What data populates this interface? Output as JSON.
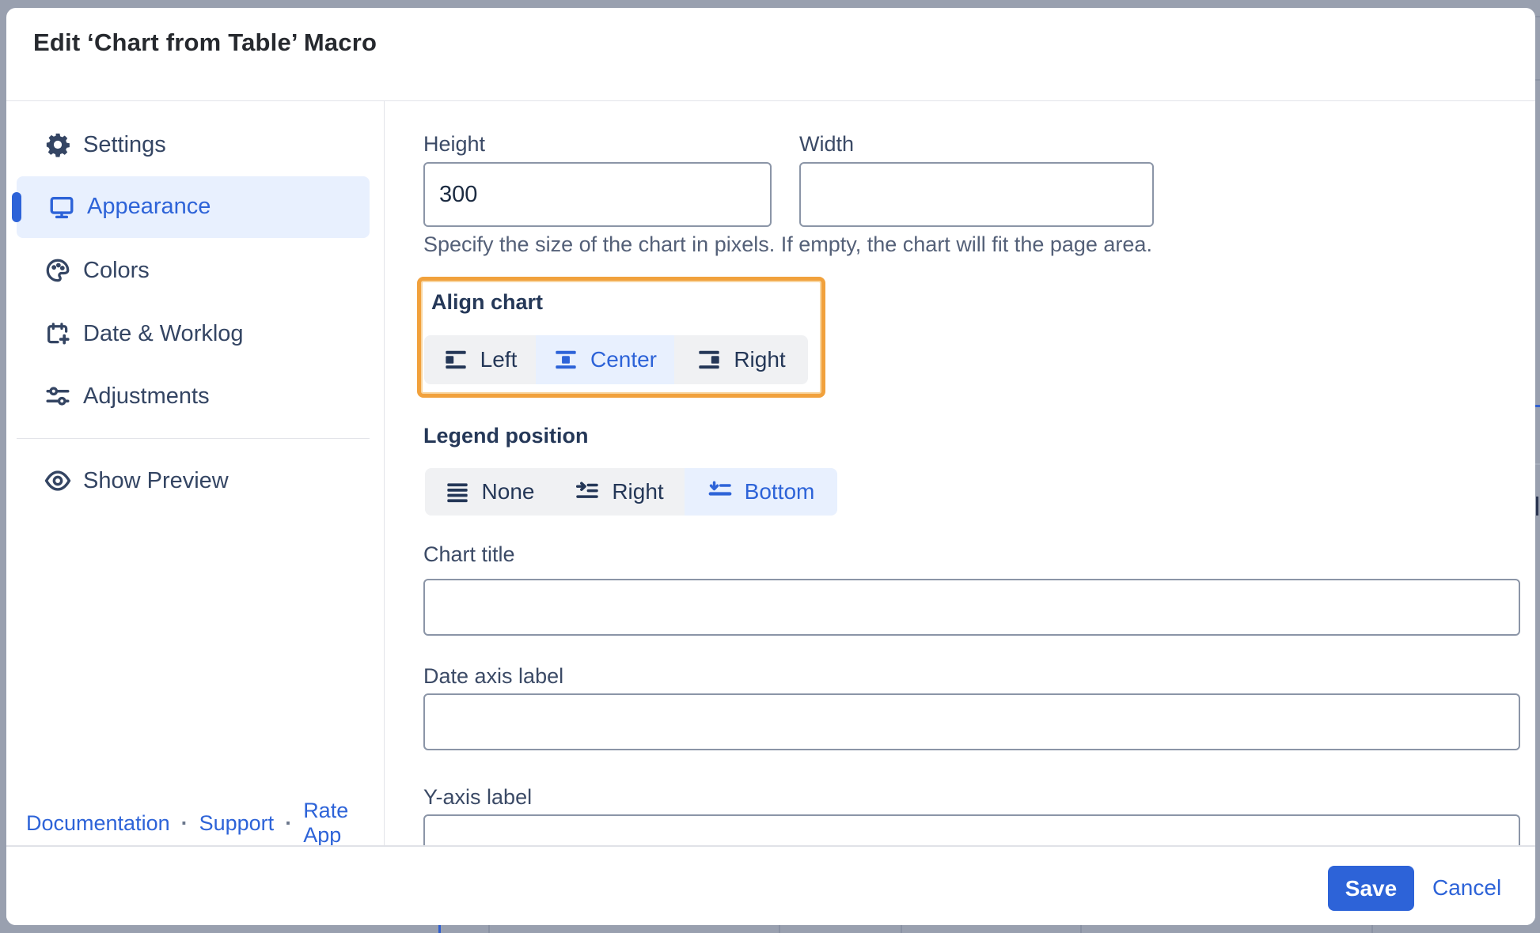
{
  "dialog": {
    "title": "Edit ‘Chart from Table’ Macro"
  },
  "sidebar": {
    "items": [
      {
        "label": "Settings",
        "icon": "gear"
      },
      {
        "label": "Appearance",
        "icon": "monitor",
        "selected": true
      },
      {
        "label": "Colors",
        "icon": "palette"
      },
      {
        "label": "Date & Worklog",
        "icon": "calendar-plus"
      },
      {
        "label": "Adjustments",
        "icon": "sliders"
      }
    ],
    "preview_label": "Show Preview",
    "footer_links": [
      "Documentation",
      "Support",
      "Rate App"
    ],
    "separator": "·"
  },
  "form": {
    "height": {
      "label": "Height",
      "value": "300"
    },
    "width": {
      "label": "Width",
      "value": ""
    },
    "size_help": "Specify the size of the chart in pixels. If empty, the chart will fit the page area.",
    "align": {
      "label": "Align chart",
      "options": [
        "Left",
        "Center",
        "Right"
      ],
      "selected": "Center"
    },
    "legend": {
      "label": "Legend position",
      "options": [
        "None",
        "Right",
        "Bottom"
      ],
      "selected": "Bottom"
    },
    "chart_title": {
      "label": "Chart title",
      "value": ""
    },
    "date_axis": {
      "label": "Date axis label",
      "value": ""
    },
    "y_axis": {
      "label": "Y-axis label",
      "value": ""
    }
  },
  "footer": {
    "save_label": "Save",
    "cancel_label": "Cancel"
  },
  "colors": {
    "accent_blue": "#2D63D8",
    "highlight_orange": "#F1A13C",
    "selected_bg": "#E8F0FE",
    "control_bg": "#F0F1F3",
    "backdrop": "#99A0AF",
    "text_navy": "#344563",
    "border_gray": "#8B95A7"
  }
}
